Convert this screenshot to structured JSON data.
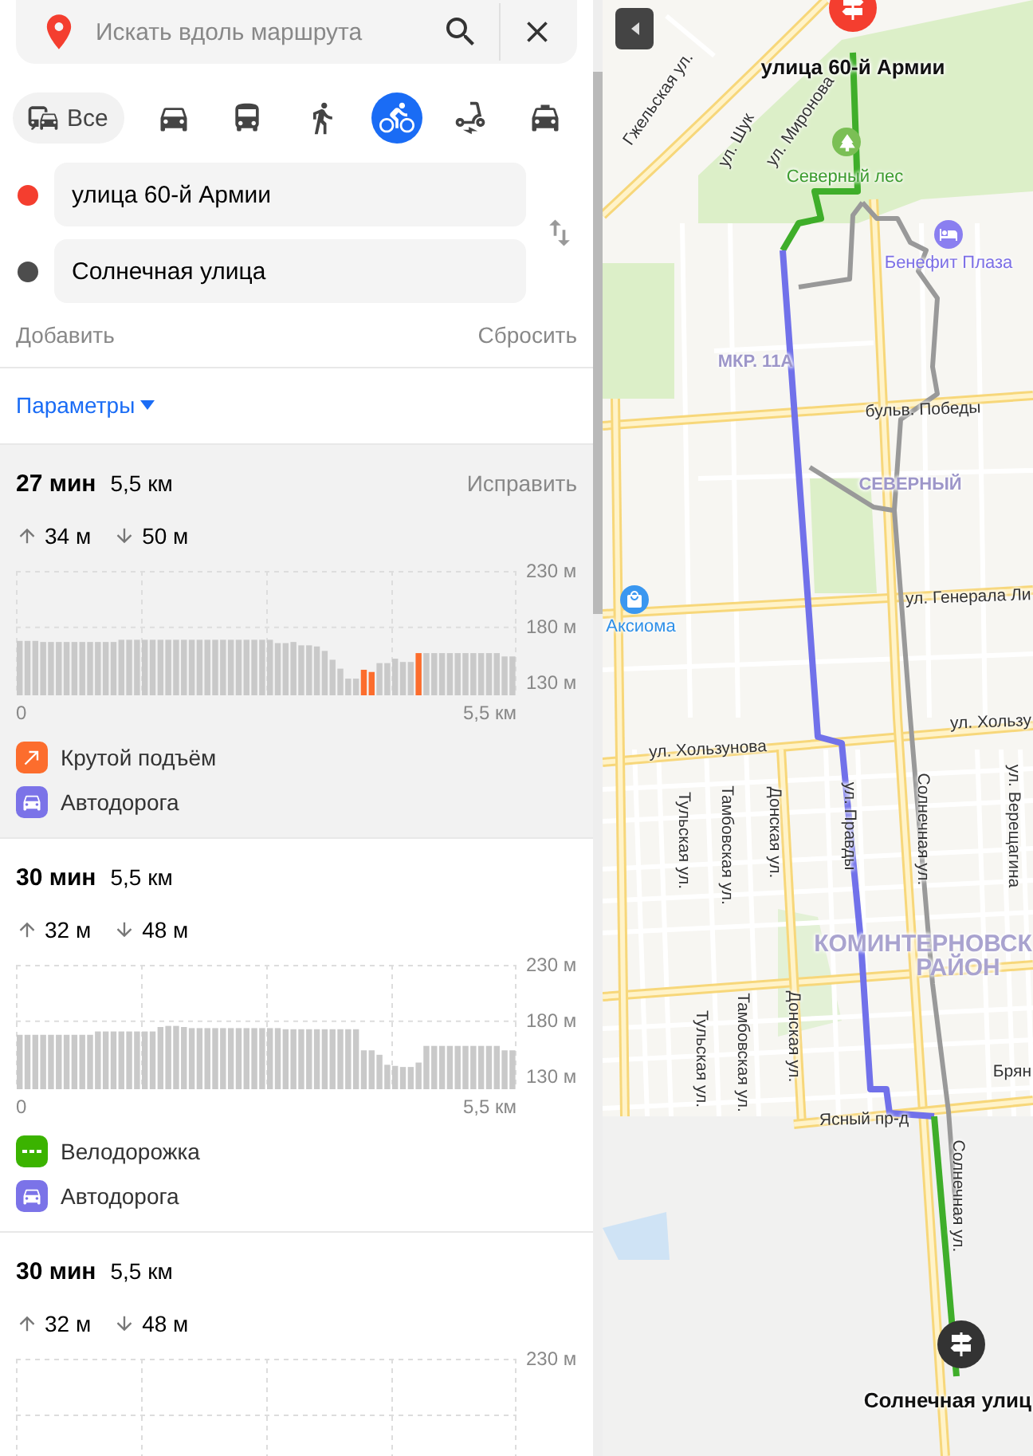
{
  "search": {
    "placeholder": "Искать вдоль маршрута"
  },
  "modes": [
    {
      "kind": "all",
      "label": "Все",
      "selected": false
    },
    {
      "kind": "car",
      "selected": false
    },
    {
      "kind": "bus",
      "selected": false
    },
    {
      "kind": "walk",
      "selected": false
    },
    {
      "kind": "bike",
      "selected": true
    },
    {
      "kind": "scooter",
      "selected": false
    },
    {
      "kind": "taxi",
      "selected": false
    }
  ],
  "waypoints": [
    {
      "value": "улица 60-й Армии",
      "color": "#f43e2f"
    },
    {
      "value": "Солнечная улица",
      "color": "#4d4d4d"
    }
  ],
  "add_label": "Добавить",
  "reset_label": "Сбросить",
  "params_label": "Параметры",
  "routes": [
    {
      "selected": true,
      "time": "27 мин",
      "distance": "5,5 км",
      "fix_label": "Исправить",
      "up": "34 м",
      "down": "50 м",
      "axis_start": "0",
      "axis_end": "5,5 км",
      "chart_data": {
        "type": "bar",
        "ylim": [
          118,
          230
        ],
        "yticks": [
          {
            "value": 230,
            "label": "230 м"
          },
          {
            "value": 180,
            "label": "180 м"
          },
          {
            "value": 130,
            "label": "130 м"
          }
        ],
        "series": [
          {
            "color": "#c9c9c9",
            "values": [
              167,
              167,
              167,
              166,
              166,
              166,
              166,
              166,
              166,
              166,
              166,
              166,
              166,
              168,
              168,
              168,
              168,
              168,
              168,
              168,
              168,
              168,
              168,
              168,
              168,
              168,
              168,
              168,
              168,
              168,
              168,
              168,
              168,
              165,
              165,
              166,
              163,
              163,
              162,
              158,
              150,
              142,
              133,
              133,
              null,
              null,
              147,
              147,
              151,
              148,
              148,
              null,
              156,
              156,
              156,
              156,
              156,
              156,
              156,
              156,
              156,
              156,
              153,
              153
            ]
          },
          {
            "color": "#fc6d2d",
            "values": [
              null,
              null,
              null,
              null,
              null,
              null,
              null,
              null,
              null,
              null,
              null,
              null,
              null,
              null,
              null,
              null,
              null,
              null,
              null,
              null,
              null,
              null,
              null,
              null,
              null,
              null,
              null,
              null,
              null,
              null,
              null,
              null,
              null,
              null,
              null,
              null,
              null,
              null,
              null,
              null,
              null,
              null,
              null,
              null,
              141,
              139,
              null,
              null,
              null,
              null,
              null,
              156,
              null,
              null,
              null,
              null,
              null,
              null,
              null,
              null,
              null,
              null,
              null,
              null
            ]
          }
        ]
      },
      "legend": [
        {
          "kind": "steep",
          "label": "Крутой подъём"
        },
        {
          "kind": "road",
          "label": "Автодорога"
        }
      ]
    },
    {
      "selected": false,
      "time": "30 мин",
      "distance": "5,5 км",
      "up": "32 м",
      "down": "48 м",
      "axis_start": "0",
      "axis_end": "5,5 км",
      "chart_data": {
        "type": "bar",
        "ylim": [
          118,
          230
        ],
        "yticks": [
          {
            "value": 230,
            "label": "230 м"
          },
          {
            "value": 180,
            "label": "180 м"
          },
          {
            "value": 130,
            "label": "130 м"
          }
        ],
        "series": [
          {
            "color": "#c9c9c9",
            "values": [
              167,
              167,
              167,
              167,
              167,
              167,
              167,
              167,
              167,
              167,
              170,
              170,
              170,
              170,
              170,
              170,
              170,
              170,
              174,
              175,
              175,
              174,
              173,
              173,
              173,
              173,
              173,
              173,
              173,
              173,
              173,
              173,
              173,
              173,
              172,
              172,
              172,
              172,
              172,
              172,
              172,
              172,
              172,
              172,
              153,
              153,
              149,
              140,
              139,
              138,
              138,
              142,
              157,
              157,
              157,
              157,
              157,
              157,
              157,
              157,
              157,
              157,
              153,
              153
            ]
          }
        ]
      },
      "legend": [
        {
          "kind": "bikelane",
          "label": "Велодорожка"
        },
        {
          "kind": "road",
          "label": "Автодорога"
        }
      ]
    },
    {
      "selected": false,
      "time": "30 мин",
      "distance": "5,5 км",
      "up": "32 м",
      "down": "48 м",
      "grid_label": "230 м"
    }
  ],
  "map": {
    "labels": [
      {
        "kind": "pin",
        "text": "улица 60-й Армии"
      },
      {
        "kind": "street",
        "text": "Гжельская ул."
      },
      {
        "kind": "street",
        "text": "ул. Шук"
      },
      {
        "kind": "street",
        "text": "ул. Миронова"
      },
      {
        "kind": "park",
        "text": "Северный лес"
      },
      {
        "kind": "hotel",
        "text": "Бенефит Плаза"
      },
      {
        "kind": "district",
        "text": "МКР. 11А"
      },
      {
        "kind": "street",
        "text": "бульв. Победы"
      },
      {
        "kind": "district",
        "text": "СЕВЕРНЫЙ"
      },
      {
        "kind": "shop",
        "text": "Аксиома"
      },
      {
        "kind": "street",
        "text": "ул. Генерала Ли"
      },
      {
        "kind": "street",
        "text": "ул. Хользунова"
      },
      {
        "kind": "street",
        "text": "ул. Хользу"
      },
      {
        "kind": "street",
        "text": "Тульская ул."
      },
      {
        "kind": "street",
        "text": "Тамбовская ул."
      },
      {
        "kind": "street",
        "text": "Донская ул."
      },
      {
        "kind": "street",
        "text": "ул. Правды"
      },
      {
        "kind": "street",
        "text": "Солнечная ул."
      },
      {
        "kind": "street",
        "text": "ул. Верещагина"
      },
      {
        "kind": "bigdistrict",
        "text": "КОМИНТЕРНОВСК"
      },
      {
        "kind": "bigdistrict",
        "text": "РАЙОН"
      },
      {
        "kind": "street",
        "text": "Тульская ул."
      },
      {
        "kind": "street",
        "text": "Тамбовская ул."
      },
      {
        "kind": "street",
        "text": "Донская ул."
      },
      {
        "kind": "street",
        "text": "Брян"
      },
      {
        "kind": "street",
        "text": "Ясный пр-д"
      },
      {
        "kind": "street",
        "text": "Солнечная ул."
      },
      {
        "kind": "pin",
        "text": "Солнечная улиц"
      }
    ]
  }
}
